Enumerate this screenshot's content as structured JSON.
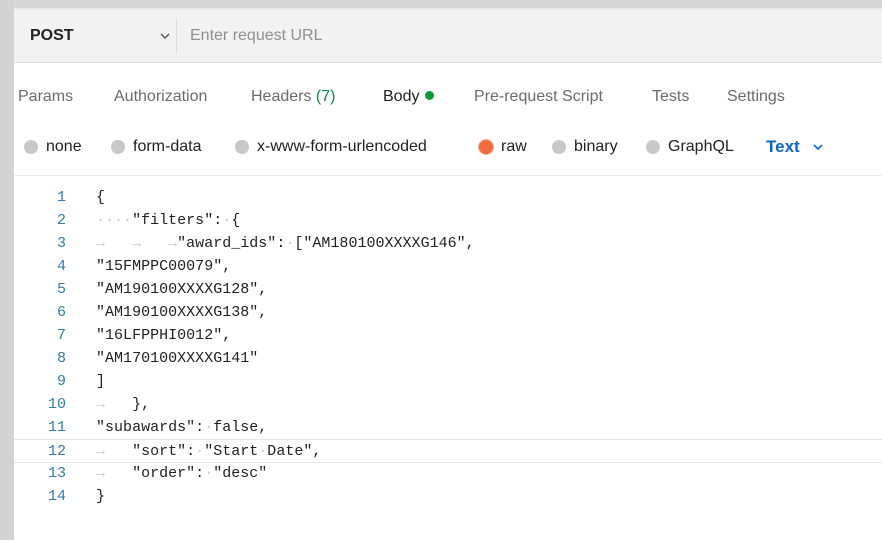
{
  "request": {
    "method": "POST",
    "url_value": "",
    "url_placeholder": "Enter request URL"
  },
  "tabs": [
    {
      "label": "Params"
    },
    {
      "label": "Authorization"
    },
    {
      "label": "Headers ",
      "count": "(7)"
    },
    {
      "label": "Body",
      "active": true
    },
    {
      "label": "Pre-request Script"
    },
    {
      "label": "Tests"
    },
    {
      "label": "Settings"
    }
  ],
  "body_types": {
    "options": [
      "none",
      "form-data",
      "x-www-form-urlencoded",
      "raw",
      "binary",
      "GraphQL"
    ],
    "selected": "raw",
    "language": "Text"
  },
  "editor": {
    "line_numbers": [
      "1",
      "2",
      "3",
      "4",
      "5",
      "6",
      "7",
      "8",
      "9",
      "10",
      "11",
      "12",
      "13",
      "14"
    ],
    "lines": [
      "{",
      "····\"filters\":·{",
      "→   →   →\"award_ids\":·[\"AM180100XXXXG146\",",
      "\"15FMPPC00079\",",
      "\"AM190100XXXXG128\",",
      "\"AM190100XXXXG138\",",
      "\"16LFPPHI0012\",",
      "\"AM170100XXXXG141\"",
      "]",
      "→   },",
      "\"subawards\":·false,",
      "→   \"sort\":·\"Start·Date\",",
      "→   \"order\":·\"desc\"",
      "}"
    ]
  },
  "colors": {
    "accent_blue": "#0c64d6",
    "body_dot_green": "#0b9a3c",
    "raw_radio_orange": "#f26b3a",
    "line_number": "#2f7ea5"
  }
}
